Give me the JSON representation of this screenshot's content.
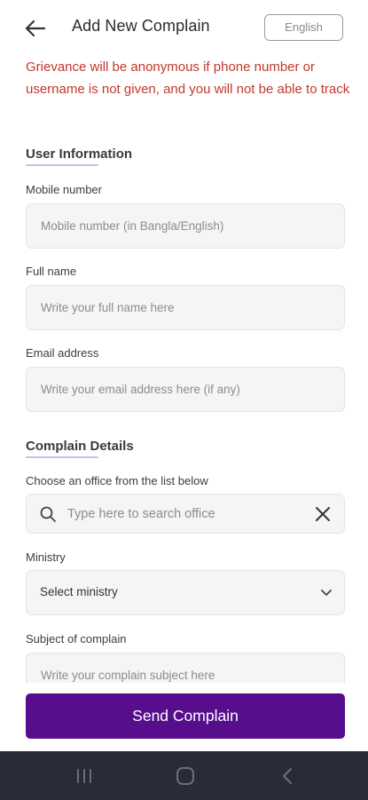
{
  "header": {
    "title": "Add New Complain",
    "language": "English"
  },
  "warning": "Grievance will be anonymous if phone number or username is not given, and you will not be able to track",
  "user_info": {
    "section_title": "User Information",
    "mobile": {
      "label": "Mobile number",
      "placeholder": "Mobile number (in Bangla/English)"
    },
    "full_name": {
      "label": "Full name",
      "placeholder": "Write your full name here"
    },
    "email": {
      "label": "Email address",
      "placeholder": "Write your email address here (if any)"
    }
  },
  "complain_details": {
    "section_title": "Complain Details",
    "office": {
      "label": "Choose an office from the list below",
      "placeholder": "Type here to search office"
    },
    "ministry": {
      "label": "Ministry",
      "selected": "Select ministry"
    },
    "subject": {
      "label": "Subject of complain",
      "placeholder": "Write your complain subject here"
    }
  },
  "submit_label": "Send Complain",
  "colors": {
    "accent": "#560e8c",
    "warning": "#c0392b",
    "nav_bar": "#292b36"
  },
  "icons": {
    "back": "arrow-left-icon",
    "search": "search-icon",
    "clear": "close-icon",
    "dropdown": "chevron-down-icon",
    "nav_recents": "recent-apps-icon",
    "nav_home": "home-icon",
    "nav_back": "back-icon"
  }
}
